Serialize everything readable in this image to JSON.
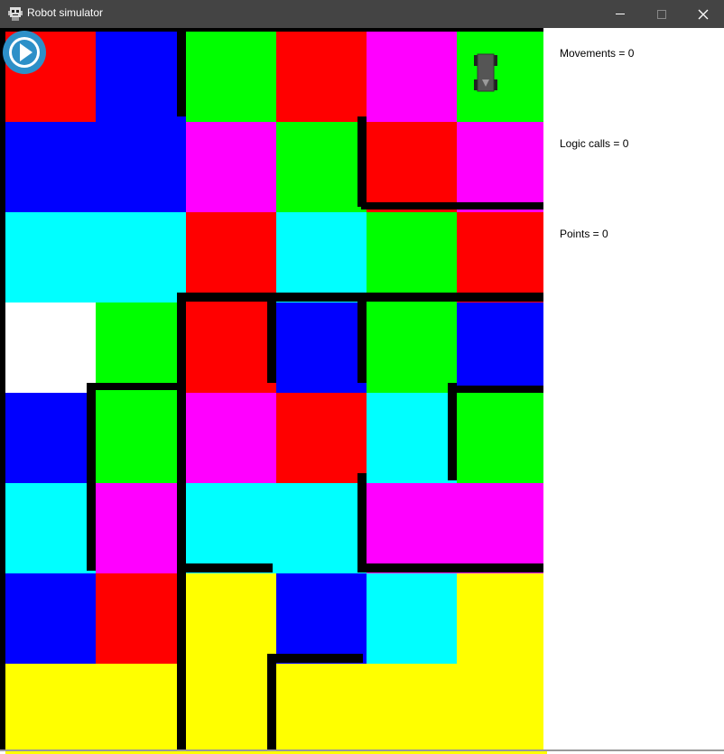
{
  "window": {
    "title": "Robot simulator",
    "app_icon": "robot-icon",
    "controls": [
      "minimize-icon",
      "maximize-icon",
      "close-icon"
    ]
  },
  "colors": {
    "red": "#ff0000",
    "blue": "#0000ff",
    "green": "#00ff00",
    "magenta": "#ff00ff",
    "cyan": "#00ffff",
    "white": "#ffffff",
    "yellow": "#ffff00",
    "wall": "#000000",
    "titlebar": "#444444",
    "play_button": "#2d90c8",
    "robot_body": "#555555"
  },
  "board": {
    "rows": 8,
    "cols": 6,
    "cells": [
      [
        "red",
        "blue",
        "green",
        "red",
        "magenta",
        "green"
      ],
      [
        "blue",
        "blue",
        "magenta",
        "green",
        "red",
        "magenta"
      ],
      [
        "cyan",
        "cyan",
        "red",
        "cyan",
        "green",
        "red"
      ],
      [
        "white",
        "green",
        "red",
        "blue",
        "green",
        "blue"
      ],
      [
        "blue",
        "green",
        "magenta",
        "red",
        "cyan",
        "green"
      ],
      [
        "cyan",
        "magenta",
        "cyan",
        "cyan",
        "magenta",
        "magenta"
      ],
      [
        "blue",
        "red",
        "yellow",
        "blue",
        "cyan",
        "yellow"
      ],
      [
        "yellow",
        "yellow",
        "yellow",
        "yellow",
        "yellow",
        "yellow"
      ]
    ]
  },
  "controls": {
    "play_icon": "play-icon"
  },
  "robot": {
    "row": 0,
    "col": 5,
    "facing": "down",
    "icon": "robot-icon"
  },
  "stats": {
    "movements": "Movements = 0",
    "logic_calls": "Logic calls = 0",
    "points": "Points = 0"
  }
}
